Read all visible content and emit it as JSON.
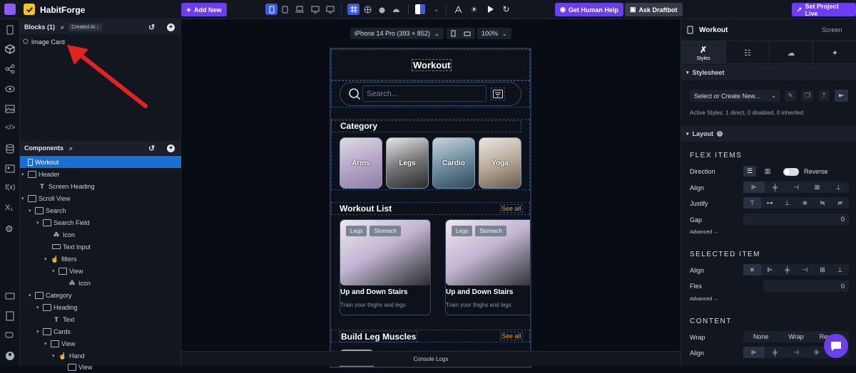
{
  "app": {
    "name": "HabitForge"
  },
  "toolbar": {
    "add_new": "Add New",
    "get_human_help": "Get Human Help",
    "ask_draftbot": "Ask Draftbot",
    "set_project_live": "Set Project Live"
  },
  "blocks": {
    "title": "Blocks (1)",
    "sort": "Created At ↓",
    "items": [
      "Image Card"
    ]
  },
  "components": {
    "title": "Components",
    "tree": [
      "Workout",
      "Header",
      "Screen Heading",
      "Scroll View",
      "Search",
      "Search Field",
      "Icon",
      "Text Input",
      "filters",
      "View",
      "Icon",
      "Category",
      "Heading",
      "Text",
      "Cards",
      "View",
      "Hand",
      "View"
    ]
  },
  "canvas": {
    "device": "iPhone 14 Pro (393 × 852)",
    "zoom": "100%",
    "console": "Console Logs"
  },
  "phone": {
    "title": "Workout",
    "search_placeholder": "Search...",
    "category_heading": "Category",
    "categories": [
      "Arms",
      "Legs",
      "Cardio",
      "Yoga"
    ],
    "workout_list_heading": "Workout List",
    "see_all": "See all",
    "cards": [
      {
        "tags": [
          "Legs",
          "Stomach"
        ],
        "title": "Up and Down Stairs",
        "subtitle": "Train your thighs and legs"
      },
      {
        "tags": [
          "Legs",
          "Stomach"
        ],
        "title": "Up and Down Stairs",
        "subtitle": "Train your thighs and legs"
      }
    ],
    "build_heading": "Build Leg Muscles",
    "see_all_2": "See all"
  },
  "right": {
    "title": "Workout",
    "type": "Screen",
    "styles_tab": "Styles",
    "stylesheet": "Stylesheet",
    "select_or_create": "Select or Create New...",
    "active_styles": "Active Styles: 1 direct, 0 disabled, 0 inherited",
    "layout": "Layout",
    "flex_items": "FLEX ITEMS",
    "direction": "Direction",
    "reverse": "Reverse",
    "align": "Align",
    "justify": "Justify",
    "gap": "Gap",
    "gap_value": "0",
    "advanced": "Advanced →",
    "selected_item": "SELECTED ITEM",
    "flex": "Flex",
    "flex_value": "0",
    "content": "CONTENT",
    "wrap": "Wrap",
    "wrap_options": [
      "None",
      "Wrap",
      "Reverse"
    ]
  },
  "colors": {
    "accent": "#6b3ff0",
    "selected": "#1a6fd6",
    "see_all": "#f0a020",
    "arrow": "#e52222"
  }
}
